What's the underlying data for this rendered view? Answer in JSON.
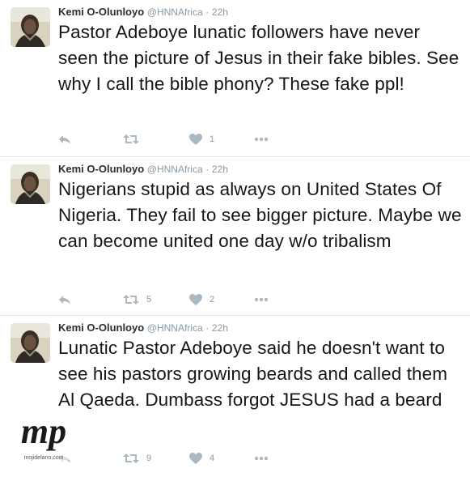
{
  "tweets": [
    {
      "name": "Kemi O-Olunloyo",
      "handle": "@HNNAfrica",
      "separator": "·",
      "time": "22h",
      "text": "Pastor Adeboye lunatic followers have never seen the picture of Jesus in their fake bibles. See why I call the bible phony? These fake ppl!",
      "retweets": "",
      "likes": "1"
    },
    {
      "name": "Kemi O-Olunloyo",
      "handle": "@HNNAfrica",
      "separator": "·",
      "time": "22h",
      "text": "Nigerians stupid as always on United States Of Nigeria. They fail to see bigger picture. Maybe we can become united one day w/o tribalism",
      "retweets": "5",
      "likes": "2"
    },
    {
      "name": "Kemi O-Olunloyo",
      "handle": "@HNNAfrica",
      "separator": "·",
      "time": "22h",
      "text": "Lunatic Pastor Adeboye said he doesn't want to see his pastors growing beards and called them Al Qaeda. Dumbass forgot JESUS had a beard",
      "retweets": "9",
      "likes": "4"
    }
  ],
  "watermark": {
    "logo_text": "mp",
    "sub_text": "mojidelano.com"
  },
  "colors": {
    "icon": "#aab8c2",
    "meta": "#8899a6",
    "text": "#14171a",
    "divider": "#e1e8ed"
  }
}
